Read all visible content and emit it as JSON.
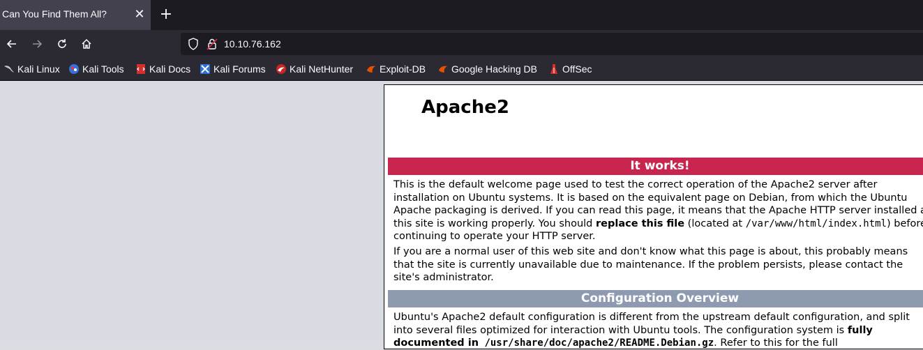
{
  "tab": {
    "title": "Can You Find Them All?",
    "close_icon": "close-icon",
    "new_tab_icon": "plus-icon"
  },
  "nav": {
    "url": "10.10.76.162",
    "icons": [
      "back-arrow-icon",
      "forward-arrow-icon",
      "reload-icon",
      "home-icon",
      "shield-icon",
      "insecure-lock-icon"
    ]
  },
  "bookmarks": [
    {
      "label": "Kali Linux",
      "icon": "kali-dragon-icon"
    },
    {
      "label": "Kali Tools",
      "icon": "kali-tools-icon"
    },
    {
      "label": "Kali Docs",
      "icon": "kali-docs-icon"
    },
    {
      "label": "Kali Forums",
      "icon": "kali-forums-icon"
    },
    {
      "label": "Kali NetHunter",
      "icon": "nethunter-icon"
    },
    {
      "label": "Exploit-DB",
      "icon": "exploit-db-icon"
    },
    {
      "label": "Google Hacking DB",
      "icon": "ghdb-icon"
    },
    {
      "label": "OffSec",
      "icon": "offsec-icon"
    }
  ],
  "page": {
    "title": "Apache2",
    "works_heading": "It works!",
    "p1_a": "This is the default welcome page used to test the correct operation of the Apache2 server after installation on Ubuntu systems. It is based on the equivalent page on Debian, from which the Ubuntu Apache packaging is derived. If you can read this page, it means that the Apache HTTP server installed at this site is working properly. You should ",
    "p1_bold": "replace this file",
    "p1_b": " (located at ",
    "p1_code": "/var/www/html/index.html",
    "p1_c": ") before continuing to operate your HTTP server.",
    "p2": "If you are a normal user of this web site and don't know what this page is about, this probably means that the site is currently unavailable due to maintenance. If the problem persists, please contact the site's administrator.",
    "config_heading": "Configuration Overview",
    "p3_a": "Ubuntu's Apache2 default configuration is different from the upstream default configuration, and split into several files optimized for interaction with Ubuntu tools. The configuration system is ",
    "p3_bold": "fully documented in",
    "p3_code": " /usr/share/doc/apache2/README.Debian.gz",
    "p3_b": ". Refer to this for the full"
  },
  "colors": {
    "red_bar": "#c7254e",
    "grey_bar": "#8d9ab0",
    "chrome_dark": "#2b2a33"
  }
}
